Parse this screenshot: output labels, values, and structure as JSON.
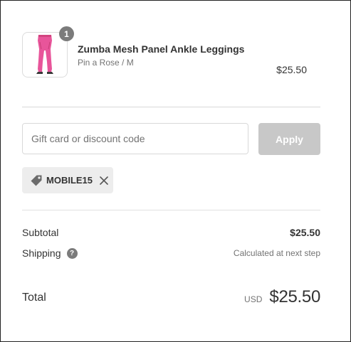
{
  "cart": {
    "item": {
      "quantity": "1",
      "name": "Zumba Mesh Panel Ankle Leggings",
      "variant": "Pin a Rose / M",
      "price": "$25.50",
      "image_icon": "leggings-thumbnail"
    }
  },
  "discount": {
    "placeholder": "Gift card or discount code",
    "value": "",
    "apply_label": "Apply",
    "applied_code": "MOBILE15",
    "tag_icon": "tag-icon",
    "remove_icon": "close-icon"
  },
  "summary": {
    "subtotal_label": "Subtotal",
    "subtotal_value": "$25.50",
    "shipping_label": "Shipping",
    "shipping_help_icon": "question-icon",
    "shipping_value": "Calculated at next step",
    "total_label": "Total",
    "total_currency": "USD",
    "total_value": "$25.50"
  },
  "colors": {
    "text": "#333333",
    "muted": "#737373",
    "button_disabled": "#c8c8c8",
    "product_pink": "#e8559a",
    "chip_bg": "#ededed"
  }
}
